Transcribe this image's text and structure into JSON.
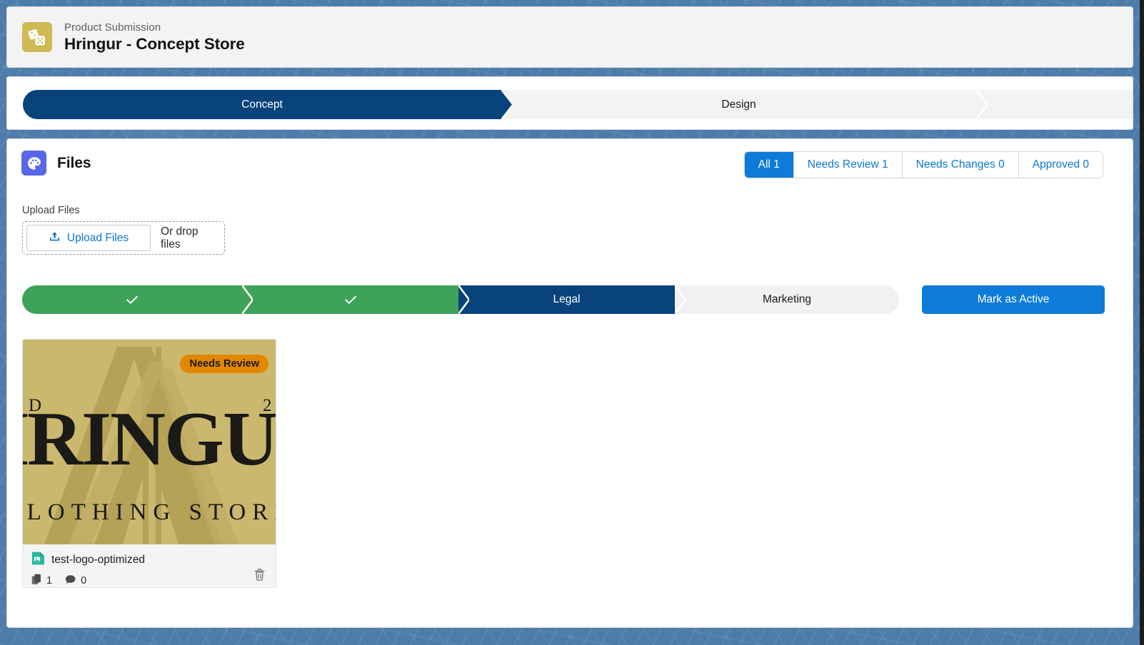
{
  "header": {
    "icon": "dice-icon",
    "eyebrow": "Product Submission",
    "title": "Hringur - Concept Store",
    "icon_color": "#cfb955"
  },
  "stage_path": {
    "steps": [
      {
        "label": "Concept",
        "state": "active"
      },
      {
        "label": "Design",
        "state": "upcoming"
      },
      {
        "label": "",
        "state": "upcoming"
      }
    ],
    "active_color": "#08437c",
    "inactive_color": "#f3f3f3"
  },
  "files_section": {
    "icon": "palette-icon",
    "icon_color": "#5867e8",
    "title": "Files",
    "filters": [
      {
        "label": "All 1",
        "active": true
      },
      {
        "label": "Needs Review 1",
        "active": false
      },
      {
        "label": "Needs Changes 0",
        "active": false
      },
      {
        "label": "Approved 0",
        "active": false
      }
    ],
    "active_filter_color": "#0d7cd9",
    "link_color": "#0b76d1"
  },
  "upload": {
    "label": "Upload Files",
    "button_label": "Upload Files",
    "button_icon": "upload-icon",
    "drop_text": "Or drop files"
  },
  "review_path": {
    "steps": [
      {
        "label": "",
        "state": "done",
        "icon": "check-icon"
      },
      {
        "label": "",
        "state": "done",
        "icon": "check-icon"
      },
      {
        "label": "Legal",
        "state": "current"
      },
      {
        "label": "Marketing",
        "state": "upcoming"
      }
    ],
    "done_color": "#3ea359",
    "current_color": "#08437c",
    "upcoming_color": "#f1f1f1"
  },
  "mark_active": {
    "label": "Mark as Active",
    "color": "#0d7cd9"
  },
  "file_card": {
    "status_badge": "Needs Review",
    "status_color": "#e38700",
    "file_name": "test-logo-optimized",
    "file_icon": "image-file-icon",
    "file_icon_color": "#2bb8a0",
    "versions_icon": "copy-icon",
    "versions_count": "1",
    "comments_icon": "comment-icon",
    "comments_count": "0",
    "delete_icon": "trash-icon",
    "thumbnail": {
      "background_color": "#cbb86f",
      "brand_text": "HRINGUR",
      "sub_text": "CLOTHING STORE",
      "left_mark": "D",
      "right_mark": "2"
    }
  }
}
